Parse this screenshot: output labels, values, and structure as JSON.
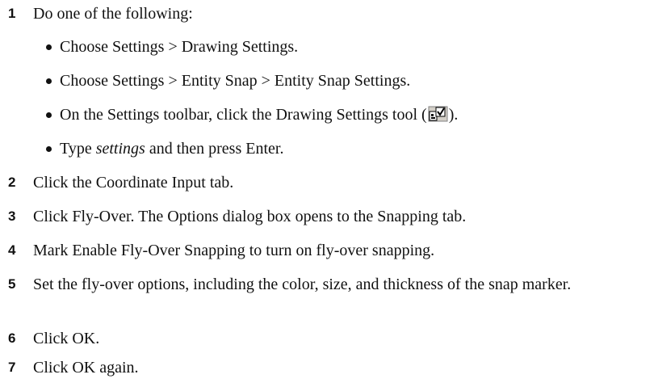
{
  "steps": [
    {
      "num": "1",
      "text": "Do one of the following:"
    },
    {
      "num": "2",
      "text": "Click the Coordinate Input tab."
    },
    {
      "num": "3",
      "text": "Click Fly-Over. The Options dialog box opens to the Snapping tab."
    },
    {
      "num": "4",
      "text": "Mark Enable Fly-Over Snapping to turn on fly-over snapping."
    },
    {
      "num": "5",
      "text": "Set the fly-over options, including the color, size, and thickness of the snap marker."
    },
    {
      "num": "6",
      "text": "Click OK."
    },
    {
      "num": "7",
      "text": "Click OK again."
    }
  ],
  "bullets": [
    {
      "text": "Choose Settings > Drawing Settings."
    },
    {
      "text": "Choose Settings > Entity Snap > Entity Snap Settings."
    },
    {
      "text_before": "On the Settings toolbar, click the Drawing Settings tool (",
      "icon": "drawing-settings-tool-icon",
      "text_after": ")."
    },
    {
      "italic": "settings",
      "text_after": " and then press Enter.",
      "text_before": "Type "
    }
  ]
}
